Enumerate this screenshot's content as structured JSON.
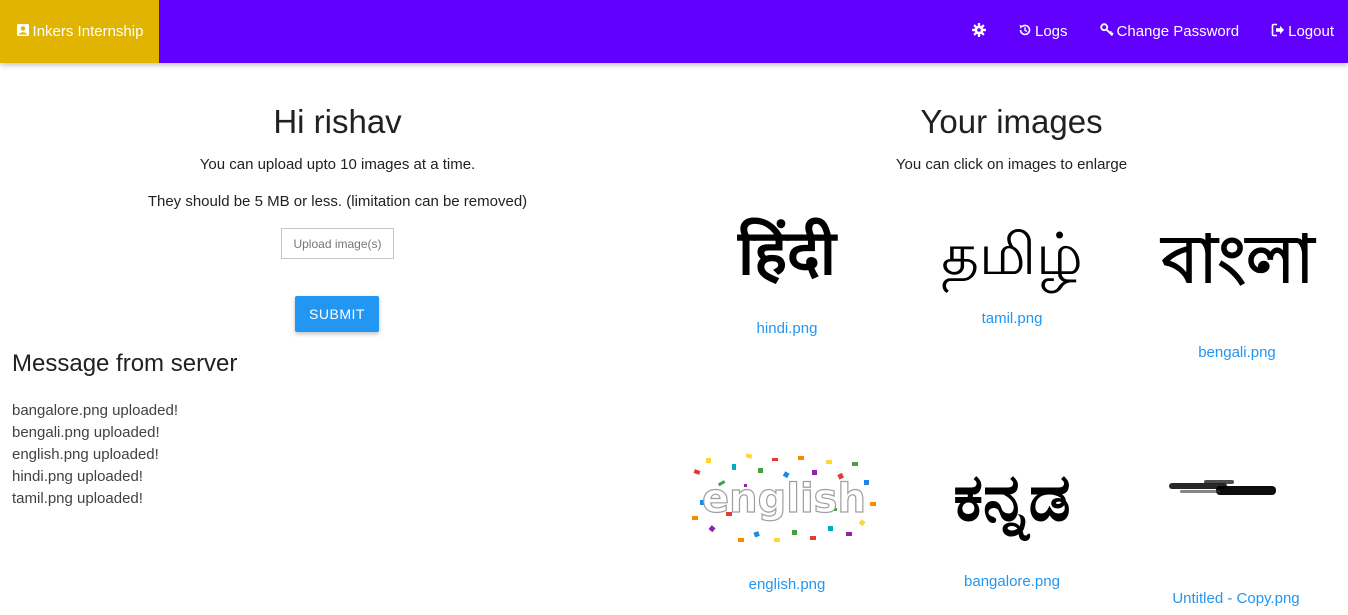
{
  "nav": {
    "brand": "Inkers Internship",
    "logs": "Logs",
    "change_password": "Change Password",
    "logout": "Logout"
  },
  "left": {
    "greeting": "Hi rishav",
    "info_limit": "You can upload upto 10 images at a time.",
    "info_size": "They should be 5 MB or less. (limitation can be removed)",
    "upload_label": "Upload image(s)",
    "submit_label": "SUBMIT"
  },
  "messages": {
    "title": "Message from server",
    "items": [
      "bangalore.png uploaded!",
      "bengali.png uploaded!",
      "english.png uploaded!",
      "hindi.png uploaded!",
      "tamil.png uploaded!"
    ]
  },
  "gallery": {
    "title": "Your images",
    "hint": "You can click on images to enlarge",
    "images": [
      {
        "caption": "hindi.png",
        "image_text": "हिंदी"
      },
      {
        "caption": "tamil.png",
        "image_text": "தமிழ்"
      },
      {
        "caption": "bengali.png",
        "image_text": "বাংলা"
      },
      {
        "caption": "english.png",
        "image_text": "english"
      },
      {
        "caption": "bangalore.png",
        "image_text": "ಕನ್ನಡ"
      },
      {
        "caption": "Untitled - Copy.png",
        "image_text": ""
      }
    ]
  },
  "colors": {
    "navbar": "#6200ff",
    "brand": "#e0b400",
    "accent": "#2196f3"
  }
}
